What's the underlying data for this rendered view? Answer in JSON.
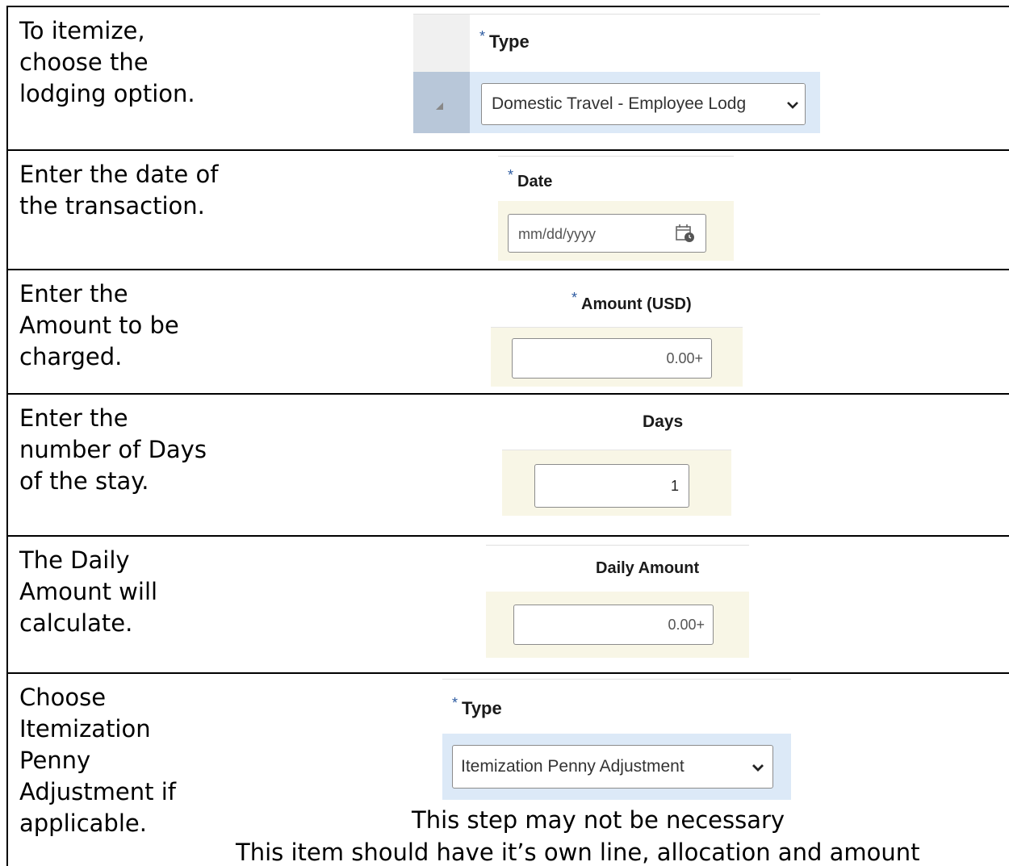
{
  "rows": [
    {
      "instruction": "To itemize, choose the lodging option.",
      "field_label": "Type",
      "required": "*",
      "field_value": "Domestic Travel - Employee Lodg",
      "chevron": "chevron-down-icon"
    },
    {
      "instruction": "Enter the date of the transaction.",
      "field_label": "Date",
      "required": "*",
      "placeholder": "mm/dd/yyyy",
      "icon": "calendar-icon"
    },
    {
      "instruction": "Enter the Amount to be charged.",
      "field_label": "Amount (USD)",
      "required": "*",
      "field_value": "0.00+"
    },
    {
      "instruction": "Enter the number of Days of the stay.",
      "field_label": "Days",
      "field_value": "1"
    },
    {
      "instruction": "The Daily Amount will calculate.",
      "field_label": "Daily Amount",
      "field_value": "0.00+"
    },
    {
      "instruction": "Choose Itemization Penny Adjustment if applicable.",
      "field_label": "Type",
      "required": "*",
      "field_value": "Itemization Penny Adjustment",
      "chevron": "chevron-down-icon",
      "note_1": "This step may not be necessary",
      "note_2": "This item should have it’s own line, allocation and amount"
    }
  ],
  "colors": {
    "row_header_blue": "#dce9f7",
    "cell_cream": "#f8f6e6",
    "required_blue": "#2c5aa0",
    "gutter": "#b8c7d9"
  }
}
